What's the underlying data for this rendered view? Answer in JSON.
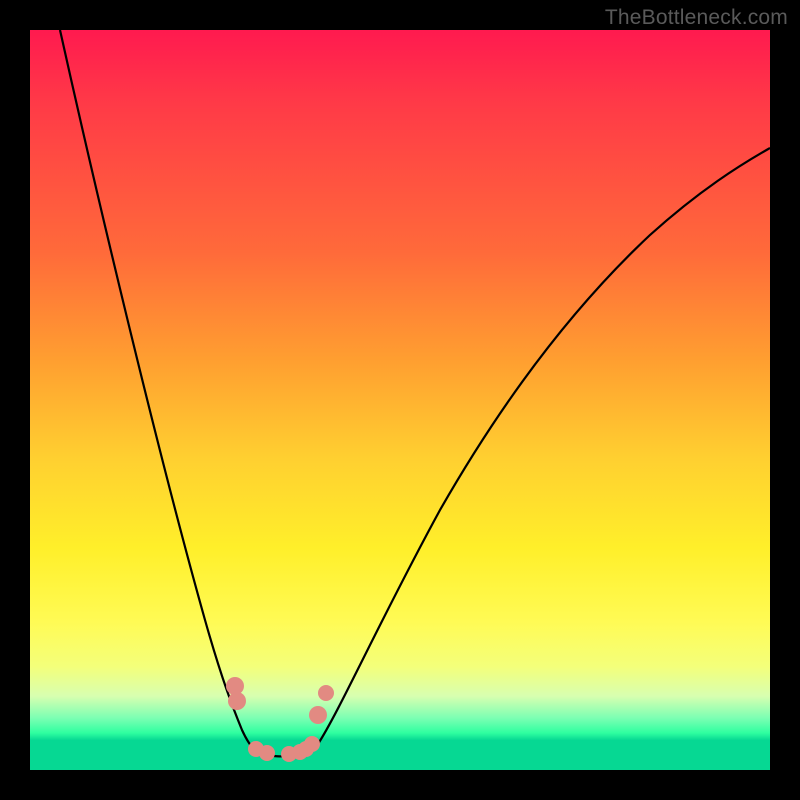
{
  "watermark": "TheBottleneck.com",
  "chart_data": {
    "type": "line",
    "title": "",
    "xlabel": "",
    "ylabel": "",
    "xlim": [
      0,
      100
    ],
    "ylim": [
      0,
      100
    ],
    "grid": false,
    "series": [
      {
        "name": "left-curve",
        "x": [
          4,
          6,
          8,
          10,
          12,
          14,
          16,
          18,
          20,
          22,
          24,
          26,
          27,
          28,
          29,
          30,
          31
        ],
        "y": [
          100,
          92,
          84,
          76,
          68,
          60,
          52,
          44,
          36,
          28,
          20,
          12,
          9,
          7,
          5,
          4,
          3
        ]
      },
      {
        "name": "valley-floor",
        "x": [
          31,
          32,
          33,
          34,
          35,
          36,
          37,
          38
        ],
        "y": [
          3,
          2.5,
          2.3,
          2.3,
          2.4,
          2.6,
          3,
          4
        ]
      },
      {
        "name": "right-curve",
        "x": [
          38,
          40,
          44,
          48,
          52,
          56,
          60,
          65,
          70,
          76,
          82,
          88,
          94,
          100
        ],
        "y": [
          4,
          7,
          14,
          22,
          30,
          38,
          45,
          53,
          60,
          66,
          72,
          77,
          81,
          84
        ]
      }
    ],
    "points": [
      {
        "name": "left-cluster-upper",
        "x": 27.0,
        "y": 11.5
      },
      {
        "name": "left-cluster-lower",
        "x": 27.3,
        "y": 9.5
      },
      {
        "name": "valley-left-1",
        "x": 30.0,
        "y": 3.4
      },
      {
        "name": "valley-left-2",
        "x": 31.5,
        "y": 2.8
      },
      {
        "name": "valley-right-1",
        "x": 34.5,
        "y": 2.7
      },
      {
        "name": "valley-right-2",
        "x": 36.0,
        "y": 3.0
      },
      {
        "name": "valley-right-3",
        "x": 36.8,
        "y": 3.4
      },
      {
        "name": "valley-right-4",
        "x": 37.5,
        "y": 4.2
      },
      {
        "name": "right-rising-1",
        "x": 38.3,
        "y": 8.0
      },
      {
        "name": "right-rising-2",
        "x": 39.5,
        "y": 11.0
      }
    ],
    "gradient_stops": [
      {
        "pos": 0.0,
        "color": "#ff1a4f"
      },
      {
        "pos": 0.3,
        "color": "#ff6a3a"
      },
      {
        "pos": 0.58,
        "color": "#ffd030"
      },
      {
        "pos": 0.8,
        "color": "#fffb55"
      },
      {
        "pos": 0.93,
        "color": "#7bffb3"
      },
      {
        "pos": 0.96,
        "color": "#06d893"
      }
    ]
  }
}
